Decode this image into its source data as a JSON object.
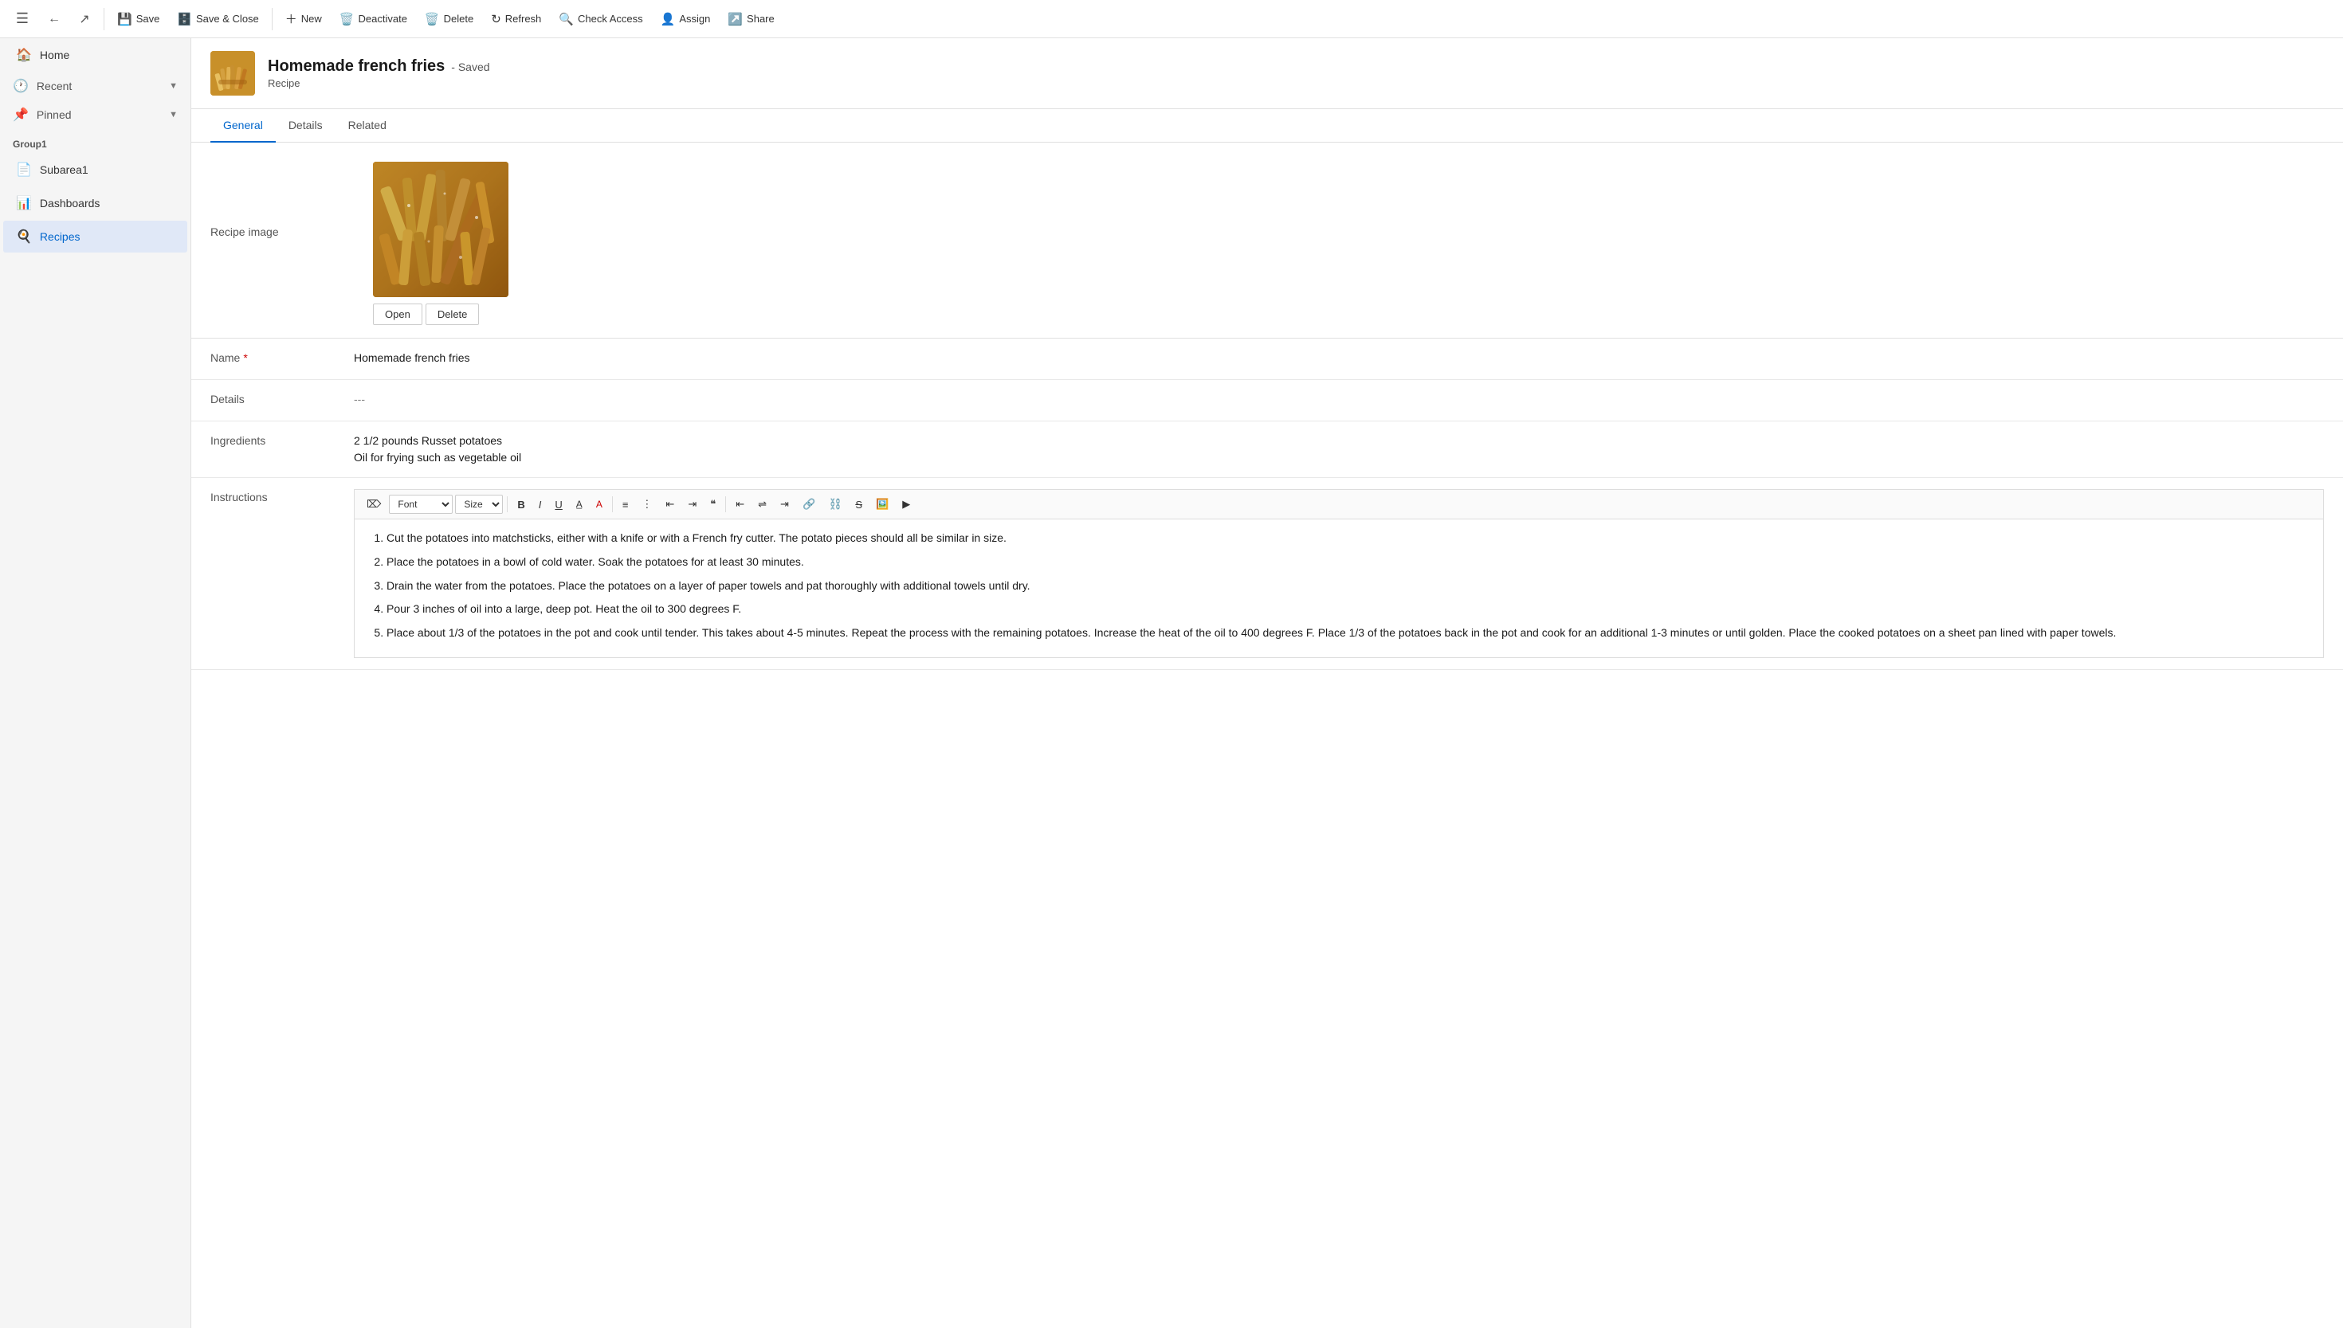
{
  "toolbar": {
    "menu_icon": "☰",
    "back_icon": "←",
    "forward_icon": "↗",
    "save_label": "Save",
    "save_close_label": "Save & Close",
    "new_label": "New",
    "deactivate_label": "Deactivate",
    "delete_label": "Delete",
    "refresh_label": "Refresh",
    "check_access_label": "Check Access",
    "assign_label": "Assign",
    "share_label": "Share"
  },
  "sidebar": {
    "items": [
      {
        "id": "home",
        "label": "Home",
        "icon": "🏠"
      },
      {
        "id": "recent",
        "label": "Recent",
        "icon": "🕐",
        "expandable": true
      },
      {
        "id": "pinned",
        "label": "Pinned",
        "icon": "📌",
        "expandable": true
      }
    ],
    "group1_label": "Group1",
    "group1_items": [
      {
        "id": "subarea1",
        "label": "Subarea1",
        "icon": "📄"
      },
      {
        "id": "dashboards",
        "label": "Dashboards",
        "icon": "📊"
      },
      {
        "id": "recipes",
        "label": "Recipes",
        "icon": "🍳",
        "active": true
      }
    ]
  },
  "record": {
    "title": "Homemade french fries",
    "saved_status": "- Saved",
    "subtitle": "Recipe",
    "tabs": [
      {
        "id": "general",
        "label": "General",
        "active": true
      },
      {
        "id": "details",
        "label": "Details",
        "active": false
      },
      {
        "id": "related",
        "label": "Related",
        "active": false
      }
    ],
    "image_label": "Recipe image",
    "image_open_btn": "Open",
    "image_delete_btn": "Delete",
    "name_label": "Name",
    "name_value": "Homemade french fries",
    "details_label": "Details",
    "details_value": "---",
    "ingredients_label": "Ingredients",
    "ingredients_line1": "2 1/2 pounds Russet potatoes",
    "ingredients_line2": "Oil for frying such as vegetable oil",
    "instructions_label": "Instructions",
    "rte_font_label": "Font",
    "rte_size_label": "Size",
    "instructions_items": [
      "Cut the potatoes into matchsticks, either with a knife or with a French fry cutter. The potato pieces should all be similar in size.",
      "Place the potatoes in a bowl of cold water. Soak the potatoes for at least 30 minutes.",
      "Drain the water from the potatoes. Place the potatoes on a layer of paper towels and pat thoroughly with additional towels until dry.",
      "Pour 3 inches of oil into a large, deep pot. Heat the oil to 300 degrees F.",
      "Place about 1/3 of the potatoes in the pot and cook until tender. This takes about 4-5 minutes. Repeat the process with the remaining potatoes. Increase the heat of the oil to 400 degrees F. Place 1/3 of the potatoes back in the pot and cook for an additional 1-3 minutes or until golden. Place the cooked potatoes on a sheet pan lined with paper towels."
    ]
  }
}
